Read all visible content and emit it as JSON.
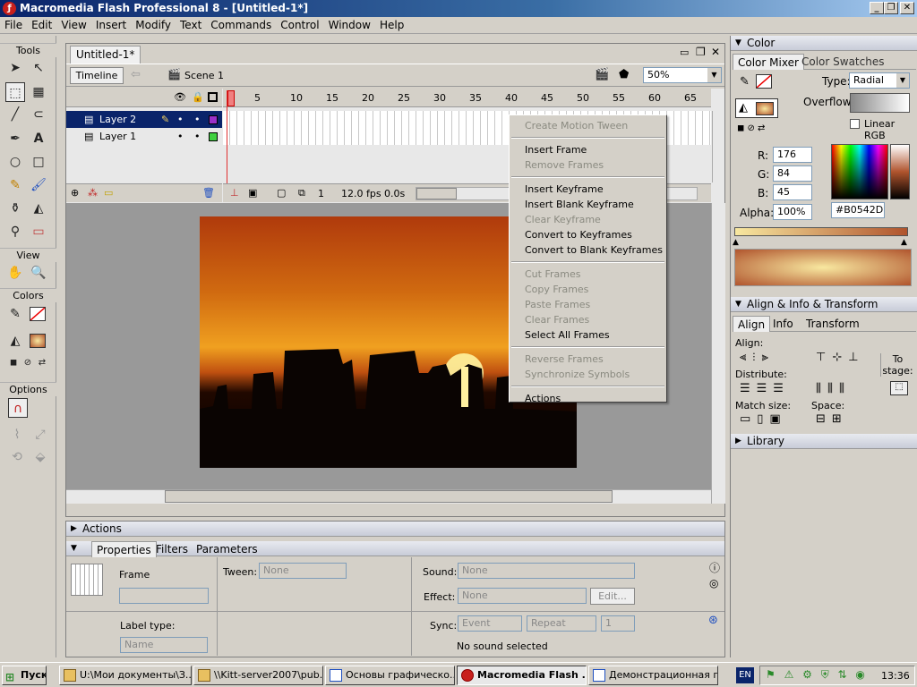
{
  "window": {
    "title": "Macromedia Flash Professional 8 - [Untitled-1*]"
  },
  "menubar": [
    "File",
    "Edit",
    "View",
    "Insert",
    "Modify",
    "Text",
    "Commands",
    "Control",
    "Window",
    "Help"
  ],
  "tools": {
    "label": "Tools",
    "view_label": "View",
    "colors_label": "Colors",
    "options_label": "Options"
  },
  "document": {
    "tab": "Untitled-1*",
    "timeline_btn": "Timeline",
    "scene": "Scene 1",
    "zoom": "50%"
  },
  "timeline": {
    "layers": [
      {
        "name": "Layer 2"
      },
      {
        "name": "Layer 1"
      }
    ],
    "ruler": [
      "1",
      "5",
      "10",
      "15",
      "20",
      "25",
      "30",
      "35",
      "40",
      "45",
      "50",
      "55",
      "60",
      "65"
    ],
    "frame": "1",
    "fps": "12.0 fps",
    "time": "0.0s"
  },
  "context_menu": [
    {
      "label": "Create Motion Tween",
      "disabled": true
    },
    {
      "sep": true
    },
    {
      "label": "Insert Frame",
      "disabled": false
    },
    {
      "label": "Remove Frames",
      "disabled": true
    },
    {
      "sep": true
    },
    {
      "label": "Insert Keyframe",
      "disabled": false
    },
    {
      "label": "Insert Blank Keyframe",
      "disabled": false
    },
    {
      "label": "Clear Keyframe",
      "disabled": true
    },
    {
      "label": "Convert to Keyframes",
      "disabled": false
    },
    {
      "label": "Convert to Blank Keyframes",
      "disabled": false
    },
    {
      "sep": true
    },
    {
      "label": "Cut Frames",
      "disabled": true
    },
    {
      "label": "Copy Frames",
      "disabled": true
    },
    {
      "label": "Paste Frames",
      "disabled": true
    },
    {
      "label": "Clear Frames",
      "disabled": true
    },
    {
      "label": "Select All Frames",
      "disabled": false
    },
    {
      "sep": true
    },
    {
      "label": "Reverse Frames",
      "disabled": true
    },
    {
      "label": "Synchronize Symbols",
      "disabled": true
    },
    {
      "sep": true
    },
    {
      "label": "Actions",
      "disabled": false
    }
  ],
  "color_panel": {
    "title": "Color",
    "tab_mixer": "Color Mixer",
    "tab_swatches": "Color Swatches",
    "type_label": "Type:",
    "type_value": "Radial",
    "overflow_label": "Overflow:",
    "linear_rgb": "Linear RGB",
    "r_label": "R:",
    "r": "176",
    "g_label": "G:",
    "g": "84",
    "b_label": "B:",
    "b": "45",
    "alpha_label": "Alpha:",
    "alpha": "100%",
    "hex": "#B0542D",
    "colors": {
      "gradient_start": "#f8e8a0",
      "gradient_end": "#b0542d"
    }
  },
  "align_panel": {
    "title": "Align & Info & Transform",
    "tabs": [
      "Align",
      "Info",
      "Transform"
    ],
    "align_label": "Align:",
    "distribute_label": "Distribute:",
    "match_label": "Match size:",
    "space_label": "Space:",
    "to_stage": "To stage:"
  },
  "library": {
    "title": "Library"
  },
  "actions": {
    "title": "Actions"
  },
  "properties": {
    "tabs": [
      "Properties",
      "Filters",
      "Parameters"
    ],
    "frame_label": "Frame",
    "tween_label": "Tween:",
    "tween_value": "None",
    "sound_label": "Sound:",
    "sound_value": "None",
    "effect_label": "Effect:",
    "effect_value": "None",
    "edit": "Edit...",
    "label_type": "Label type:",
    "label_type_value": "Name",
    "sync_label": "Sync:",
    "sync_value": "Event",
    "repeat": "Repeat",
    "repeat_count": "1",
    "no_sound": "No sound selected"
  },
  "taskbar": {
    "start": "Пуск",
    "items": [
      "U:\\Мои документы\\З...",
      "\\\\Kitt-server2007\\pub...",
      "Основы графическо...",
      "Macromedia Flash ...",
      "Демонстрационная г..."
    ],
    "lang": "EN",
    "clock": "13:36"
  }
}
